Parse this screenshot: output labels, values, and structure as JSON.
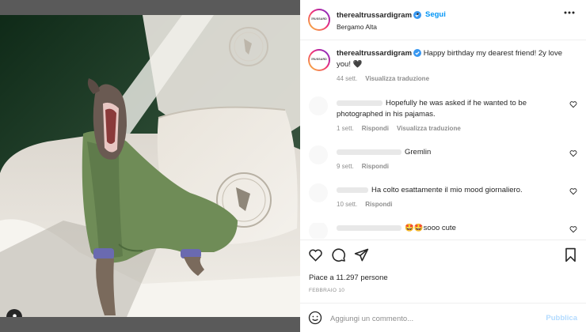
{
  "post": {
    "username": "therealtrussardigram",
    "follow_label": "Segui",
    "separator": "•",
    "location": "Bergamo Alta",
    "avatar_text": "TRUSSARDI"
  },
  "caption": {
    "username": "therealtrussardigram",
    "text": "Happy birthday my dearest friend! 2y love you! 🖤",
    "age": "44 sett.",
    "translate_label": "Visualizza traduzione"
  },
  "comments": [
    {
      "text": "Hopefully he was asked if he wanted to be photographed in his pajamas.",
      "age": "1 sett.",
      "reply_label": "Rispondi",
      "translate_label": "Visualizza traduzione"
    },
    {
      "text": "Gremlin",
      "age": "9 sett.",
      "reply_label": "Rispondi"
    },
    {
      "text": "Ha colto esattamente il mio mood giornaliero.",
      "age": "10 sett.",
      "reply_label": "Rispondi"
    },
    {
      "text": "🤩🤩sooo cute"
    }
  ],
  "engagement": {
    "likes_text": "Piace a 11.297 persone",
    "date": "FEBBRAIO 10"
  },
  "comment_box": {
    "placeholder": "Aggiungi un commento...",
    "publish_label": "Pubblica"
  },
  "colors": {
    "link_blue": "#0095f6",
    "publish_disabled": "#b3dbff",
    "verified_blue": "#3897f0",
    "secondary_text": "#8e8e8e"
  },
  "icons": {
    "more": "more-horizontal-icon",
    "like": "heart-icon",
    "comment": "comment-bubble-icon",
    "share": "paper-plane-icon",
    "save": "bookmark-icon",
    "emoji": "smiley-icon",
    "tags": "user-tag-icon",
    "verified": "verified-badge-icon"
  }
}
